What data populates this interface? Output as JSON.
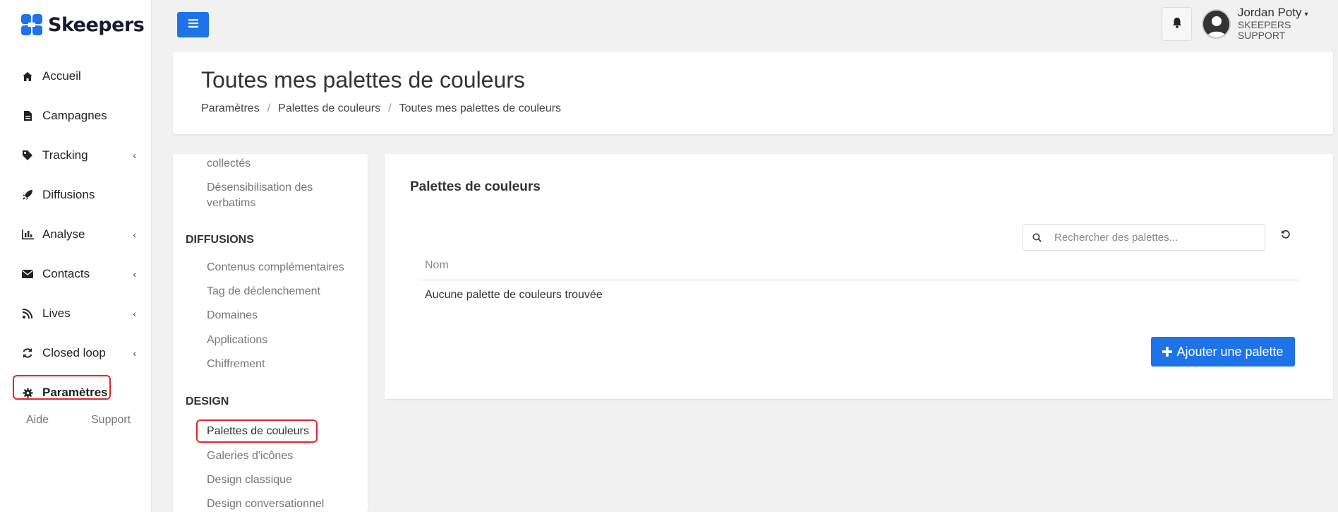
{
  "brand": {
    "name": "Skeepers"
  },
  "sidebar": {
    "items": [
      {
        "label": "Accueil",
        "icon": "home-icon",
        "has_submenu": false
      },
      {
        "label": "Campagnes",
        "icon": "document-icon",
        "has_submenu": false
      },
      {
        "label": "Tracking",
        "icon": "tag-icon",
        "has_submenu": true
      },
      {
        "label": "Diffusions",
        "icon": "rocket-icon",
        "has_submenu": false
      },
      {
        "label": "Analyse",
        "icon": "bar-chart-icon",
        "has_submenu": true
      },
      {
        "label": "Contacts",
        "icon": "envelope-icon",
        "has_submenu": true
      },
      {
        "label": "Lives",
        "icon": "rss-icon",
        "has_submenu": true
      },
      {
        "label": "Closed loop",
        "icon": "refresh-icon",
        "has_submenu": true
      },
      {
        "label": "Paramètres",
        "icon": "gear-icon",
        "has_submenu": false,
        "active": true
      }
    ],
    "footer": {
      "aide": "Aide",
      "support": "Support"
    },
    "chevron": "‹"
  },
  "topbar": {
    "menu_icon": "hamburger-icon",
    "bell_icon": "bell-icon",
    "user": {
      "name": "Jordan Poty",
      "caret": "▾",
      "org": "SKEEPERS SUPPORT"
    }
  },
  "header": {
    "title": "Toutes mes palettes de couleurs",
    "breadcrumb": [
      "Paramètres",
      "Palettes de couleurs",
      "Toutes mes palettes de couleurs"
    ],
    "separator": "/"
  },
  "settings_menu": {
    "partial_top": "collectés",
    "pre_items": [
      "Désensibilisation des",
      "verbatims"
    ],
    "sections": [
      {
        "title": "DIFFUSIONS",
        "items": [
          "Contenus complémentaires",
          "Tag de déclenchement",
          "Domaines",
          "Applications",
          "Chiffrement"
        ]
      },
      {
        "title": "DESIGN",
        "items": [
          "Palettes de couleurs",
          "Galeries d'icônes",
          "Design classique",
          "Design conversationnel"
        ]
      }
    ],
    "active_item": "Palettes de couleurs"
  },
  "main": {
    "title": "Palettes de couleurs",
    "search": {
      "placeholder": "Rechercher des palettes...",
      "value": ""
    },
    "table": {
      "columns": [
        "Nom"
      ],
      "empty_message": "Aucune palette de couleurs trouvée"
    },
    "add_button": {
      "label": "Ajouter une palette",
      "icon": "plus-icon"
    }
  },
  "colors": {
    "primary": "#1f73e8",
    "highlight": "#e0262b",
    "background": "#f1f1f1"
  }
}
